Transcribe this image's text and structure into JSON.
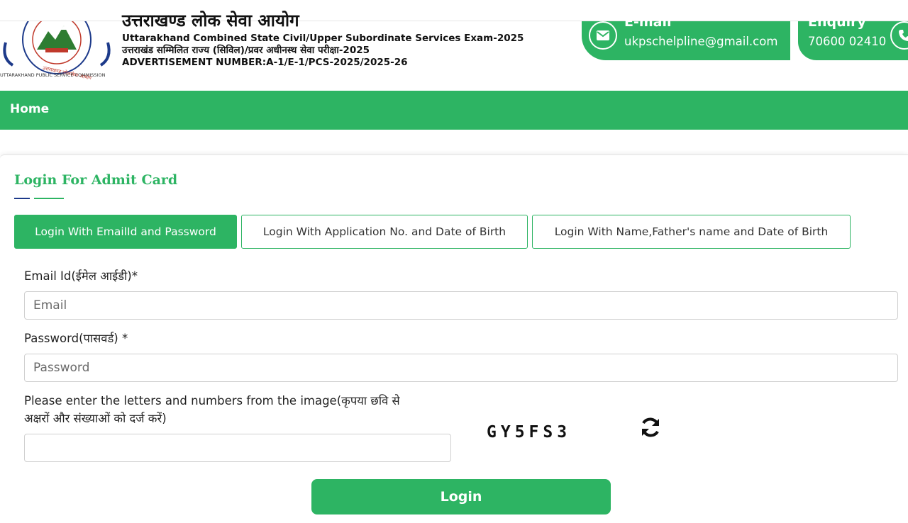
{
  "header": {
    "hindi_title": "उत्तराखण्ड लोक सेवा आयोग",
    "exam_title_en": "Uttarakhand Combined State Civil/Upper Subordinate Services Exam-2025",
    "exam_title_hi": "उत्तराखंड सम्मिलित राज्य (सिविल)/प्रवर अधीनस्थ सेवा परीक्षा-2025",
    "advertisement": "ADVERTISEMENT NUMBER:A-1/E-1/PCS-2025/2025-26",
    "logo_caption": "UTTARAKHAND PUBLIC SERVICE COMMISSION",
    "logo_ring_text": "उत्तराखण्ड लोकसेवा आयोग",
    "email_title": "E-mail",
    "email_value": "ukpschelpline@gmail.com",
    "enquiry_title": "Enquiry",
    "enquiry_value": "70600 02410"
  },
  "nav": {
    "home": "Home"
  },
  "card": {
    "title": "Login For Admit Card",
    "tabs": [
      {
        "label": "Login With EmailId and Password",
        "active": true
      },
      {
        "label": "Login With Application No. and Date of Birth",
        "active": false
      },
      {
        "label": "Login With Name,Father's name and Date of Birth",
        "active": false
      }
    ],
    "email_label": "Email Id(ईमेल आईडी)*",
    "email_placeholder": "Email",
    "password_label": "Password(पासवर्ड) *",
    "password_placeholder": "Password",
    "captcha_label_line1": "Please enter the letters and numbers from the image(कृपया छवि से",
    "captcha_label_line2": "अक्षरों और संख्याओं को दर्ज करें)",
    "captcha_value": "",
    "captcha_text": "GY5FS3",
    "login_button": "Login"
  },
  "colors": {
    "brand_green": "#2db463",
    "accent_blue": "#1d3a8a"
  },
  "icons": {
    "email": "envelope-icon",
    "enquiry": "phone-icon",
    "refresh": "refresh-icon"
  }
}
